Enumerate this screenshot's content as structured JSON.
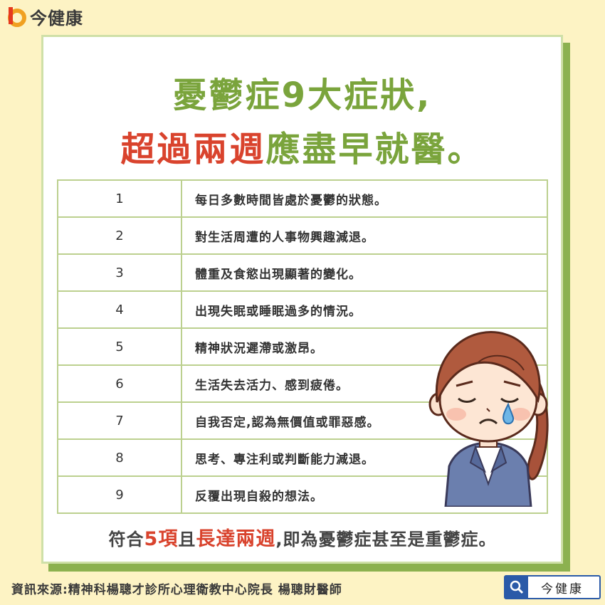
{
  "brand": {
    "name": "今健康"
  },
  "title": {
    "line1": "憂鬱症9大症狀,",
    "line2_red": "超過兩週",
    "line2_green": "應盡早就醫。"
  },
  "symptoms": [
    {
      "num": "1",
      "text": "每日多數時間皆處於憂鬱的狀態。"
    },
    {
      "num": "2",
      "text": "對生活周遭的人事物興趣減退。"
    },
    {
      "num": "3",
      "text": "體重及食慾出現顯著的變化。"
    },
    {
      "num": "4",
      "text": "出現失眠或睡眠過多的情況。"
    },
    {
      "num": "5",
      "text": "精神狀況遲滯或激昂。"
    },
    {
      "num": "6",
      "text": "生活失去活力、感到疲倦。"
    },
    {
      "num": "7",
      "text": "自我否定,認為無價值或罪惡感。"
    },
    {
      "num": "8",
      "text": "思考、專注利或判斷能力減退。"
    },
    {
      "num": "9",
      "text": "反覆出現自殺的想法。"
    }
  ],
  "footer": {
    "part1": "符合",
    "part2": "5項",
    "part3": "且",
    "part4": "長達兩週",
    "part5": ",即為憂鬱症甚至是重鬱症。"
  },
  "source": "資訊來源:精神科楊聰才診所心理衛教中心院長 楊聰財醫師",
  "search": {
    "label": "今健康"
  },
  "colors": {
    "accent_green": "#7aa43c",
    "accent_red": "#d9432d",
    "background": "#fdf3c4",
    "search_blue": "#2a5aa8"
  },
  "icons": [
    "logo-icon",
    "search-icon",
    "sad-woman-illustration"
  ]
}
